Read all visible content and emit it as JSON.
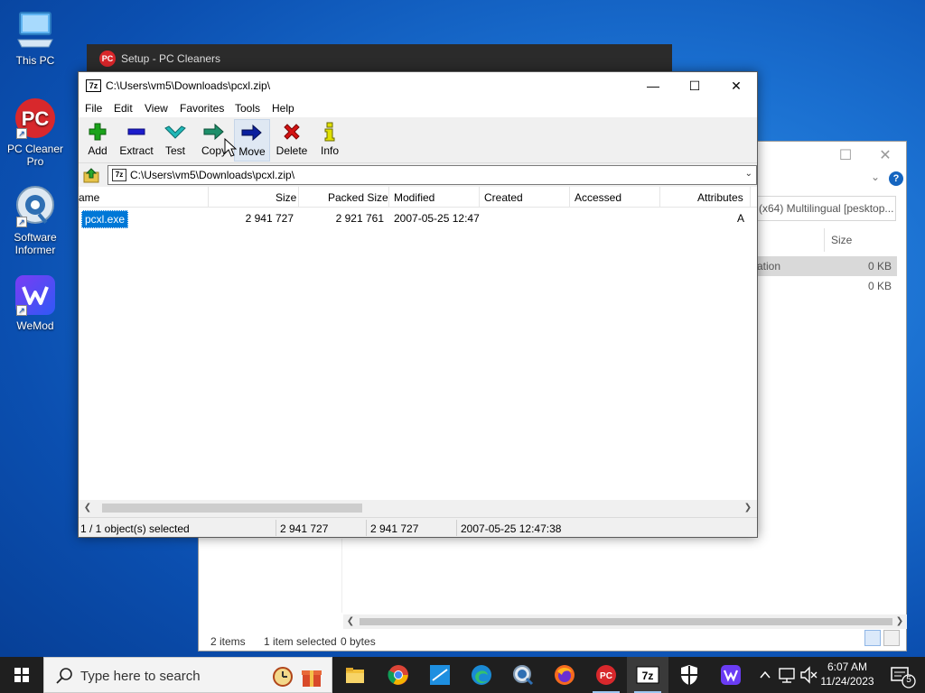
{
  "desktop": {
    "icons": [
      {
        "label": "This PC"
      },
      {
        "label": "PC Cleaner Pro"
      },
      {
        "label": "Software Informer"
      },
      {
        "label": "WeMod"
      }
    ]
  },
  "setup_window": {
    "title": "Setup - PC Cleaners",
    "logo_text": "PC"
  },
  "explorer": {
    "address_fragment": "(x64) Multilingual [pesktop...",
    "column_size": "Size",
    "rows": [
      {
        "name_fragment": "ation",
        "size": "0 KB"
      },
      {
        "name_fragment": "",
        "size": "0 KB"
      }
    ],
    "status": {
      "items": "2 items",
      "selected": "1 item selected",
      "bytes": "0 bytes"
    }
  },
  "zip": {
    "app_icon_text": "7z",
    "title": "C:\\Users\\vm5\\Downloads\\pcxl.zip\\",
    "menu": [
      "File",
      "Edit",
      "View",
      "Favorites",
      "Tools",
      "Help"
    ],
    "toolbar": [
      {
        "label": "Add",
        "icon": "plus-icon",
        "color": "#1aa31a"
      },
      {
        "label": "Extract",
        "icon": "minus-icon",
        "color": "#1c1ccc"
      },
      {
        "label": "Test",
        "icon": "check-icon",
        "color": "#20b8b8"
      },
      {
        "label": "Copy",
        "icon": "double-arrow-icon",
        "color": "#1d8f6a"
      },
      {
        "label": "Move",
        "icon": "arrow-right-icon",
        "color": "#0a1f9e"
      },
      {
        "label": "Delete",
        "icon": "x-icon",
        "color": "#d41212"
      },
      {
        "label": "Info",
        "icon": "info-icon",
        "color": "#c8c800"
      }
    ],
    "address": "C:\\Users\\vm5\\Downloads\\pcxl.zip\\",
    "columns": [
      "ame",
      "Size",
      "Packed Size",
      "Modified",
      "Created",
      "Accessed",
      "Attributes"
    ],
    "files": [
      {
        "name": "pcxl.exe",
        "size": "2 941 727",
        "packed": "2 921 761",
        "modified": "2007-05-25 12:47",
        "created": "",
        "accessed": "",
        "attributes": "A"
      }
    ],
    "status": {
      "selection": "1 / 1 object(s) selected",
      "size": "2 941 727",
      "packed": "2 941 727",
      "modified": "2007-05-25 12:47:38"
    }
  },
  "taskbar": {
    "search_placeholder": "Type here to search",
    "apps": [
      "file-explorer",
      "chrome",
      "app-blue",
      "edge",
      "search-app",
      "firefox",
      "pc-cleaner",
      "7zip",
      "security",
      "wemod"
    ],
    "time": "6:07 AM",
    "date": "11/24/2023",
    "notification_count": "5"
  },
  "colors": {
    "accent": "#0078d7",
    "desktop": "#1a6fd0",
    "taskbar": "#1f1f1f"
  }
}
